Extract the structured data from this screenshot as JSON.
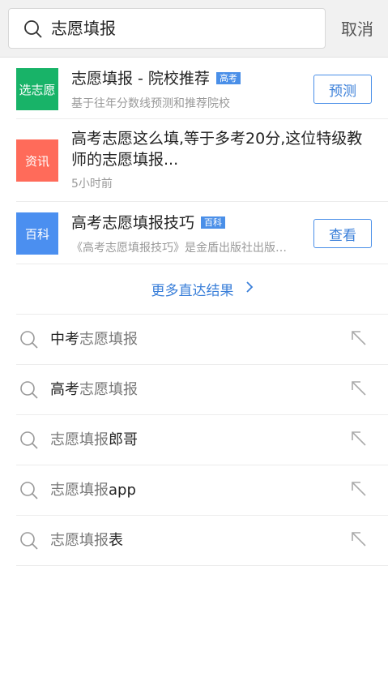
{
  "search": {
    "query": "志愿填报",
    "cancel_label": "取消"
  },
  "results": [
    {
      "badge": "选志愿",
      "title": "志愿填报 - 院校推荐",
      "tag": "高考",
      "subtitle": "基于往年分数线预测和推荐院校",
      "action": "预测"
    },
    {
      "badge": "资讯",
      "title": "高考志愿这么填,等于多考20分,这位特级教师的志愿填报...",
      "subtitle": "5小时前"
    },
    {
      "badge": "百科",
      "title": "高考志愿填报技巧",
      "tag": "百科",
      "subtitle": "《高考志愿填报技巧》是金盾出版社出版的图书",
      "action": "查看"
    }
  ],
  "more_results_label": "更多直达结果",
  "suggestions": [
    {
      "prefix": "中考",
      "query": "志愿填报",
      "suffix": ""
    },
    {
      "prefix": "高考",
      "query": "志愿填报",
      "suffix": ""
    },
    {
      "prefix": "",
      "query": "志愿填报",
      "suffix": "郎哥"
    },
    {
      "prefix": "",
      "query": "志愿填报",
      "suffix": "app"
    },
    {
      "prefix": "",
      "query": "志愿填报",
      "suffix": "表"
    }
  ],
  "colors": {
    "accent": "#4a8fe8",
    "green": "#18b368",
    "red": "#ff6b5a",
    "blue": "#4b8ff0"
  },
  "icons": {
    "search": "search-icon",
    "fill_arrow": "arrow-up-left-icon",
    "chevron": "chevron-right-icon"
  }
}
